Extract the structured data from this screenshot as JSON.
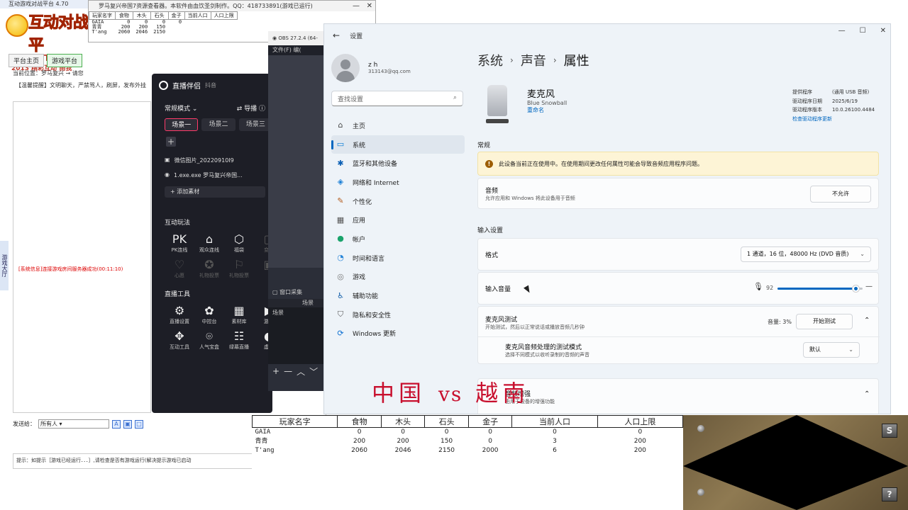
{
  "platform": {
    "title": "互动游戏对战平台 4.70",
    "logo": {
      "main": "互动对战平",
      "site": "HD.FXT365.C",
      "slogan": "2013 精彩互动 由我"
    },
    "tabs": [
      "平台主页",
      "游戏平台"
    ],
    "location": "当前位置：罗马复兴 → 请您",
    "notice": "【温馨提醒】文明聊天，严禁骂人，刷屏，发布外挂",
    "side_strip": "游戏大厅",
    "system_msg": "[系统信息]连接游戏房间服务器成功(00:11:10)",
    "send_label": "发送给：",
    "send_target": "所有人",
    "tip": "提示：如提示［游戏已经运行．．．］,请检查是否有游戏运行(解决提示游戏已启动"
  },
  "roman": {
    "title": "罗马复兴帝国7资源查看器。本软件由血饮圣剑制作。QQ：418733891(游戏已运行)",
    "headers": [
      "玩家名字",
      "食物",
      "木头",
      "石头",
      "金子",
      "当前人口",
      "人口上限"
    ],
    "rows": [
      [
        "GAIA",
        "0",
        "0",
        "0",
        "0",
        "",
        ""
      ],
      [
        "青青",
        "200",
        "200",
        "150",
        "",
        "",
        ""
      ],
      [
        "T'ang",
        "2060",
        "2046",
        "2150",
        "",
        "",
        ""
      ]
    ]
  },
  "live": {
    "name": "直播伴侣",
    "sub": "抖音",
    "mode": "常规模式",
    "guide": "导播",
    "scenes": [
      "场景一",
      "场景二",
      "场景三"
    ],
    "sources": [
      "微信图片_20220910I9",
      "1.exe.exe 罗马复兴帝国..."
    ],
    "add_source": "+ 添加素材",
    "play_title": "互动玩法",
    "play_tools": [
      {
        "icon": "PK",
        "label": "PK连线"
      },
      {
        "icon": "⌂",
        "label": "观众连线"
      },
      {
        "icon": "⬡",
        "label": "福袋"
      },
      {
        "icon": "▢",
        "label": "变身"
      },
      {
        "icon": "♡",
        "label": "心愿"
      },
      {
        "icon": "✪",
        "label": "礼物投票"
      },
      {
        "icon": "⚐",
        "label": "礼物投票"
      },
      {
        "icon": "▣",
        "label": ""
      }
    ],
    "live_title": "直播工具",
    "live_tools": [
      {
        "icon": "⚙",
        "label": "直播设置"
      },
      {
        "icon": "✿",
        "label": "中控台"
      },
      {
        "icon": "▦",
        "label": "素材库"
      },
      {
        "icon": "▶",
        "label": "游戏"
      },
      {
        "icon": "✥",
        "label": "互动工具"
      },
      {
        "icon": "⌾",
        "label": "人气宝盒"
      },
      {
        "icon": "☷",
        "label": "绿幕直播"
      },
      {
        "icon": "◐",
        "label": "虚拟"
      }
    ]
  },
  "obs": {
    "title": "OBS 27.2.4 (64-",
    "menu": "文件(F)  编(",
    "window_capture": "窗口采集",
    "scenes_header": "场景",
    "scene_label": "场景"
  },
  "settings": {
    "title": "设置",
    "user": {
      "name": "z h",
      "email": "313143@qq.com"
    },
    "search_placeholder": "查找设置",
    "nav": [
      "主页",
      "系统",
      "蓝牙和其他设备",
      "网络和 Internet",
      "个性化",
      "应用",
      "帐户",
      "时间和语言",
      "游戏",
      "辅助功能",
      "隐私和安全性",
      "Windows 更新"
    ],
    "breadcrumb": [
      "系统",
      "声音",
      "属性"
    ],
    "device": {
      "name": "麦克风",
      "model": "Blue Snowball",
      "rename": "重命名"
    },
    "driver": {
      "rows": [
        {
          "k": "提供程序",
          "v": "(通用 USB 音频)"
        },
        {
          "k": "驱动程序日期",
          "v": "2025/6/19"
        },
        {
          "k": "驱动程序版本",
          "v": "10.0.26100.4484"
        }
      ],
      "link": "检查驱动程序更新"
    },
    "general_title": "常规",
    "warning": "此设备当前正在使用中。在使用期间更改任何属性可能会导致音频应用程序问题。",
    "audio": {
      "title": "音频",
      "desc": "允许应用和 Windows 将此设备用于音频",
      "button": "不允许"
    },
    "input_title": "输入设置",
    "format": {
      "label": "格式",
      "value": "1 通道，16 位，48000 Hz (DVD 音质)"
    },
    "volume": {
      "label": "输入音量",
      "value": "92",
      "level": 92
    },
    "mic_test": {
      "title": "麦克风测试",
      "desc": "开始测试，然后以正常说话或播放音频几秒钟",
      "volume": "音量: 3%",
      "button": "开始测试"
    },
    "processing": {
      "title": "麦克风音频处理的测试模式",
      "desc": "选择不同模式以收听录制的音频的声音",
      "value": "默认"
    },
    "enhance": {
      "title": "音频增强",
      "desc": "由用于设备的增强功能"
    }
  },
  "overlay": {
    "left": "中国",
    "vs": "vs",
    "right": "越南"
  },
  "resources": {
    "headers": [
      "玩家名字",
      "食物",
      "木头",
      "石头",
      "金子",
      "当前人口",
      "人口上限"
    ],
    "rows": [
      [
        "GAIA",
        "0",
        "0",
        "0",
        "0",
        "0",
        "0"
      ],
      [
        "青青",
        "200",
        "200",
        "150",
        "0",
        "3",
        "200"
      ],
      [
        "T'ang",
        "2060",
        "2046",
        "2150",
        "2000",
        "6",
        "200"
      ]
    ]
  },
  "minimap": {
    "btn_s": "S",
    "btn_q": "?"
  }
}
